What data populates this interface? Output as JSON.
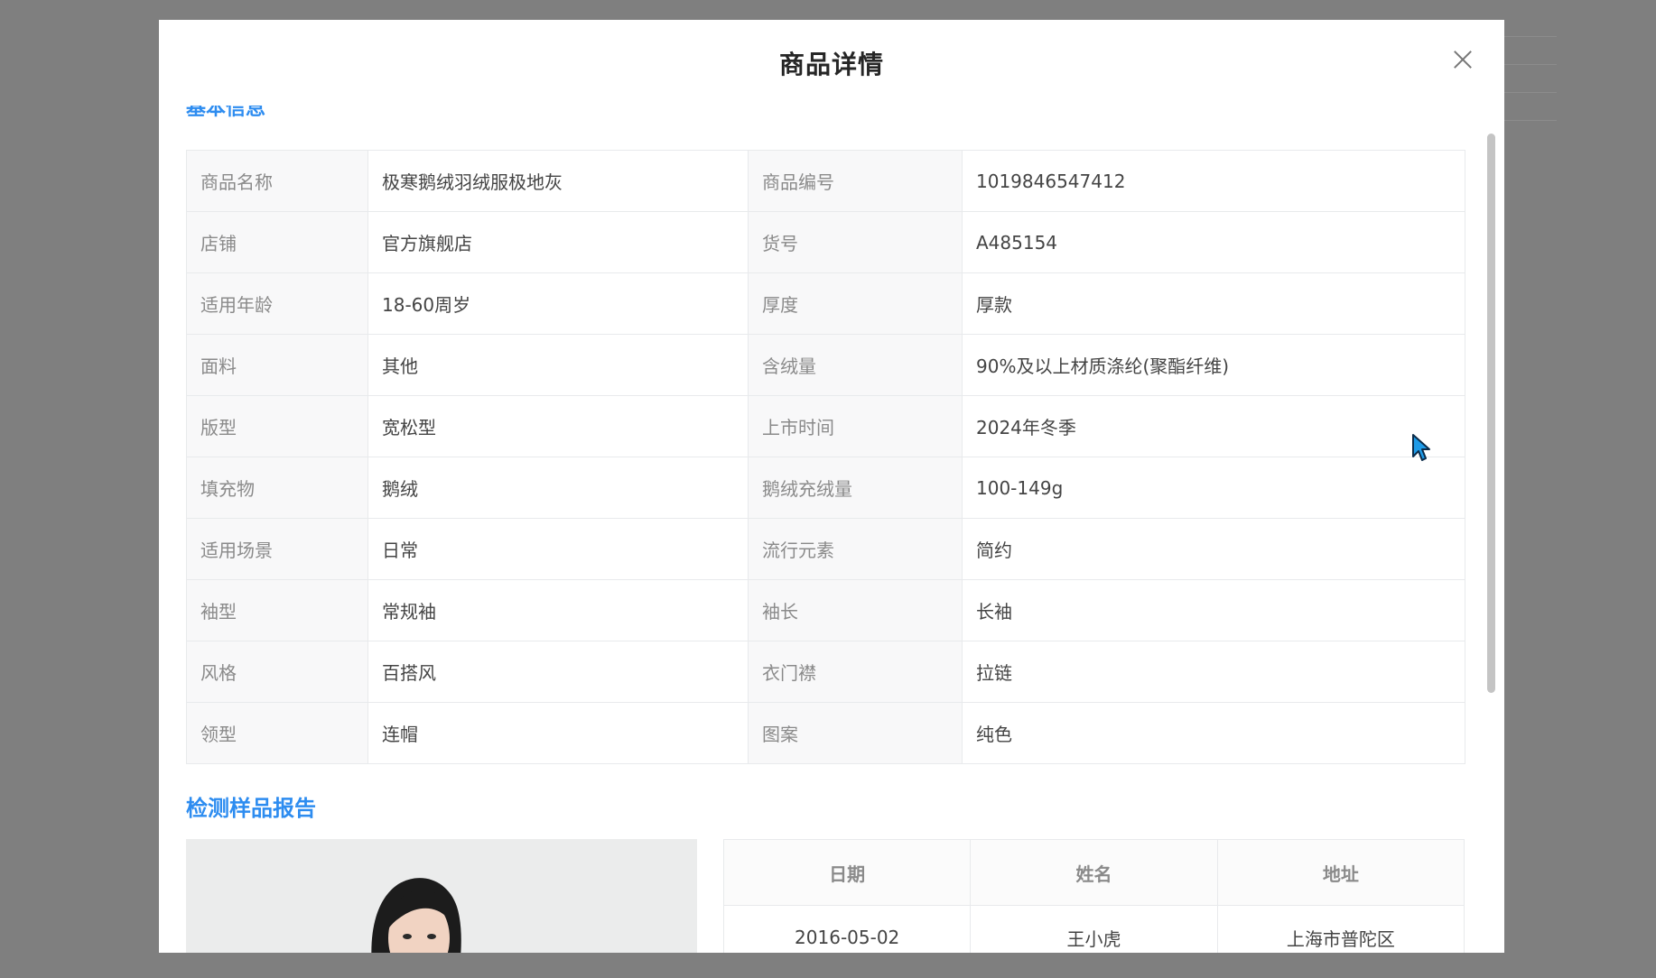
{
  "modal": {
    "title": "商品详情"
  },
  "section_basic": {
    "title": "基本信息"
  },
  "rows": [
    {
      "l1": "商品名称",
      "v1": "极寒鹅绒羽绒服极地灰",
      "l2": "商品编号",
      "v2": "1019846547412"
    },
    {
      "l1": "店铺",
      "v1": "官方旗舰店",
      "l2": "货号",
      "v2": "A485154"
    },
    {
      "l1": "适用年龄",
      "v1": "18-60周岁",
      "l2": "厚度",
      "v2": "厚款"
    },
    {
      "l1": "面料",
      "v1": "其他",
      "l2": "含绒量",
      "v2": "90%及以上材质涤纶(聚酯纤维)"
    },
    {
      "l1": "版型",
      "v1": "宽松型",
      "l2": "上市时间",
      "v2": "2024年冬季"
    },
    {
      "l1": "填充物",
      "v1": "鹅绒",
      "l2": "鹅绒充绒量",
      "v2": "100-149g"
    },
    {
      "l1": "适用场景",
      "v1": "日常",
      "l2": "流行元素",
      "v2": "简约"
    },
    {
      "l1": "袖型",
      "v1": "常规袖",
      "l2": "袖长",
      "v2": "长袖"
    },
    {
      "l1": "风格",
      "v1": "百搭风",
      "l2": "衣门襟",
      "v2": "拉链"
    },
    {
      "l1": "领型",
      "v1": "连帽",
      "l2": "图案",
      "v2": "纯色"
    }
  ],
  "section_report": {
    "title": "检测样品报告"
  },
  "report_table": {
    "headers": [
      "日期",
      "姓名",
      "地址"
    ],
    "rows": [
      [
        "2016-05-02",
        "王小虎",
        "上海市普陀区"
      ]
    ]
  },
  "colors": {
    "accent": "#2d8cf0",
    "overlay": "#7f7f7f",
    "label_bg": "#f8f8f9",
    "border": "#e8eaec"
  },
  "icons": {
    "close": "close-icon",
    "cursor": "mouse-pointer-icon"
  }
}
